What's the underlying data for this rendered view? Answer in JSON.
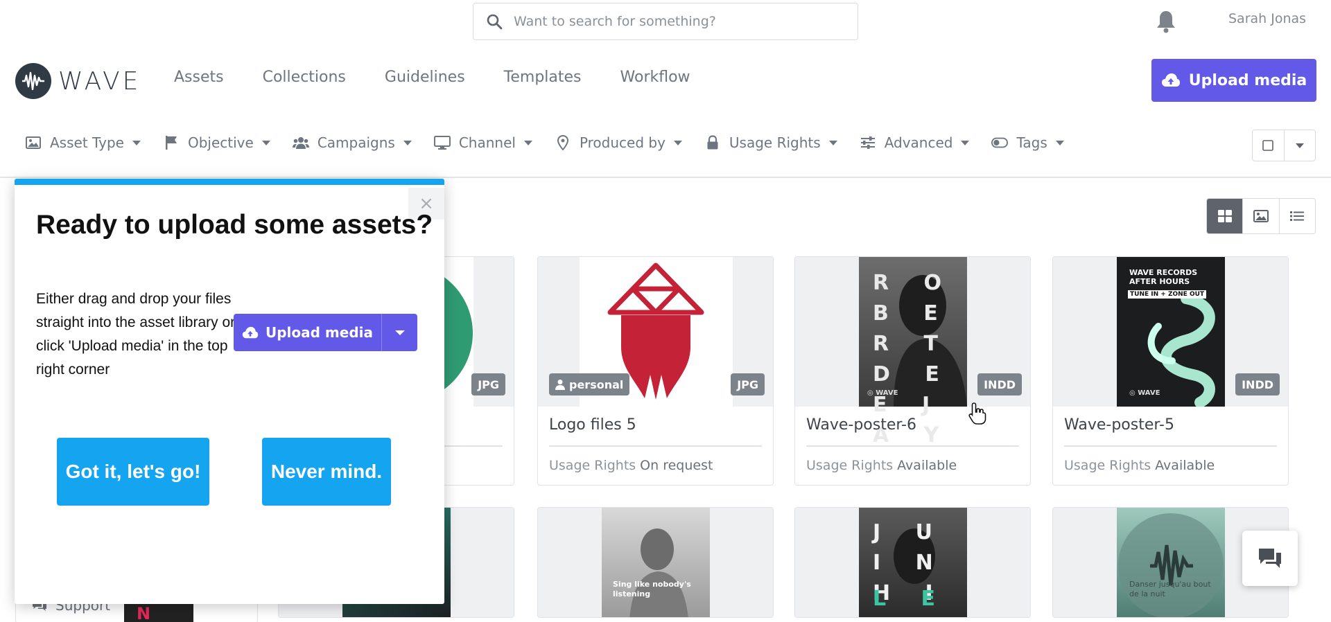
{
  "search": {
    "placeholder": "Want to search for something?"
  },
  "user": {
    "name": "Sarah Jonas"
  },
  "brand": {
    "name": "WAVE",
    "primary_color": "#6359e9",
    "accent_blue": "#15a5f0"
  },
  "nav": {
    "items": [
      {
        "label": "Assets"
      },
      {
        "label": "Collections"
      },
      {
        "label": "Guidelines"
      },
      {
        "label": "Templates"
      },
      {
        "label": "Workflow"
      }
    ],
    "upload_label": "Upload media"
  },
  "filters": [
    {
      "label": "Asset Type",
      "icon": "image-icon"
    },
    {
      "label": "Objective",
      "icon": "flag-icon"
    },
    {
      "label": "Campaigns",
      "icon": "users-icon"
    },
    {
      "label": "Channel",
      "icon": "monitor-icon"
    },
    {
      "label": "Produced by",
      "icon": "map-pin-icon"
    },
    {
      "label": "Usage Rights",
      "icon": "lock-icon"
    },
    {
      "label": "Advanced",
      "icon": "sliders-icon"
    },
    {
      "label": "Tags",
      "icon": "toggle-icon"
    }
  ],
  "popup": {
    "title": "Ready to upload some assets?",
    "body": "Either drag and drop your files straight into the asset library or click 'Upload media' in the top right corner",
    "upload_label": "Upload media",
    "confirm_label": "Got it, let's go!",
    "dismiss_label": "Never mind."
  },
  "cards": [
    {
      "title": "",
      "usage_rights_label": "",
      "usage_rights_value": "",
      "format": "JPG"
    },
    {
      "title": "Logo files 5",
      "usage_rights_label": "Usage Rights",
      "usage_rights_value": "On request",
      "format": "JPG",
      "tag": "personal"
    },
    {
      "title": "Wave-poster-6",
      "usage_rights_label": "Usage Rights",
      "usage_rights_value": "Available",
      "format": "INDD",
      "poster_letters": "R O B E R T D E E J A Y"
    },
    {
      "title": "Wave-poster-5",
      "usage_rights_label": "Usage Rights",
      "usage_rights_value": "Available",
      "format": "INDD",
      "poster_header": "WAVE RECORDS AFTER HOURS",
      "poster_sub": "TUNE IN + ZONE OUT",
      "poster_brand": "WAVE"
    }
  ],
  "row2": {
    "sing_text": "Sing like nobody's listening",
    "juni_letters": "J U I N H I",
    "lee_letters": "L E E",
    "dance_text": "Danser jusqu'au bout de la nuit",
    "na_letters": "N A"
  },
  "sidebar": {
    "support_label": "Support"
  }
}
